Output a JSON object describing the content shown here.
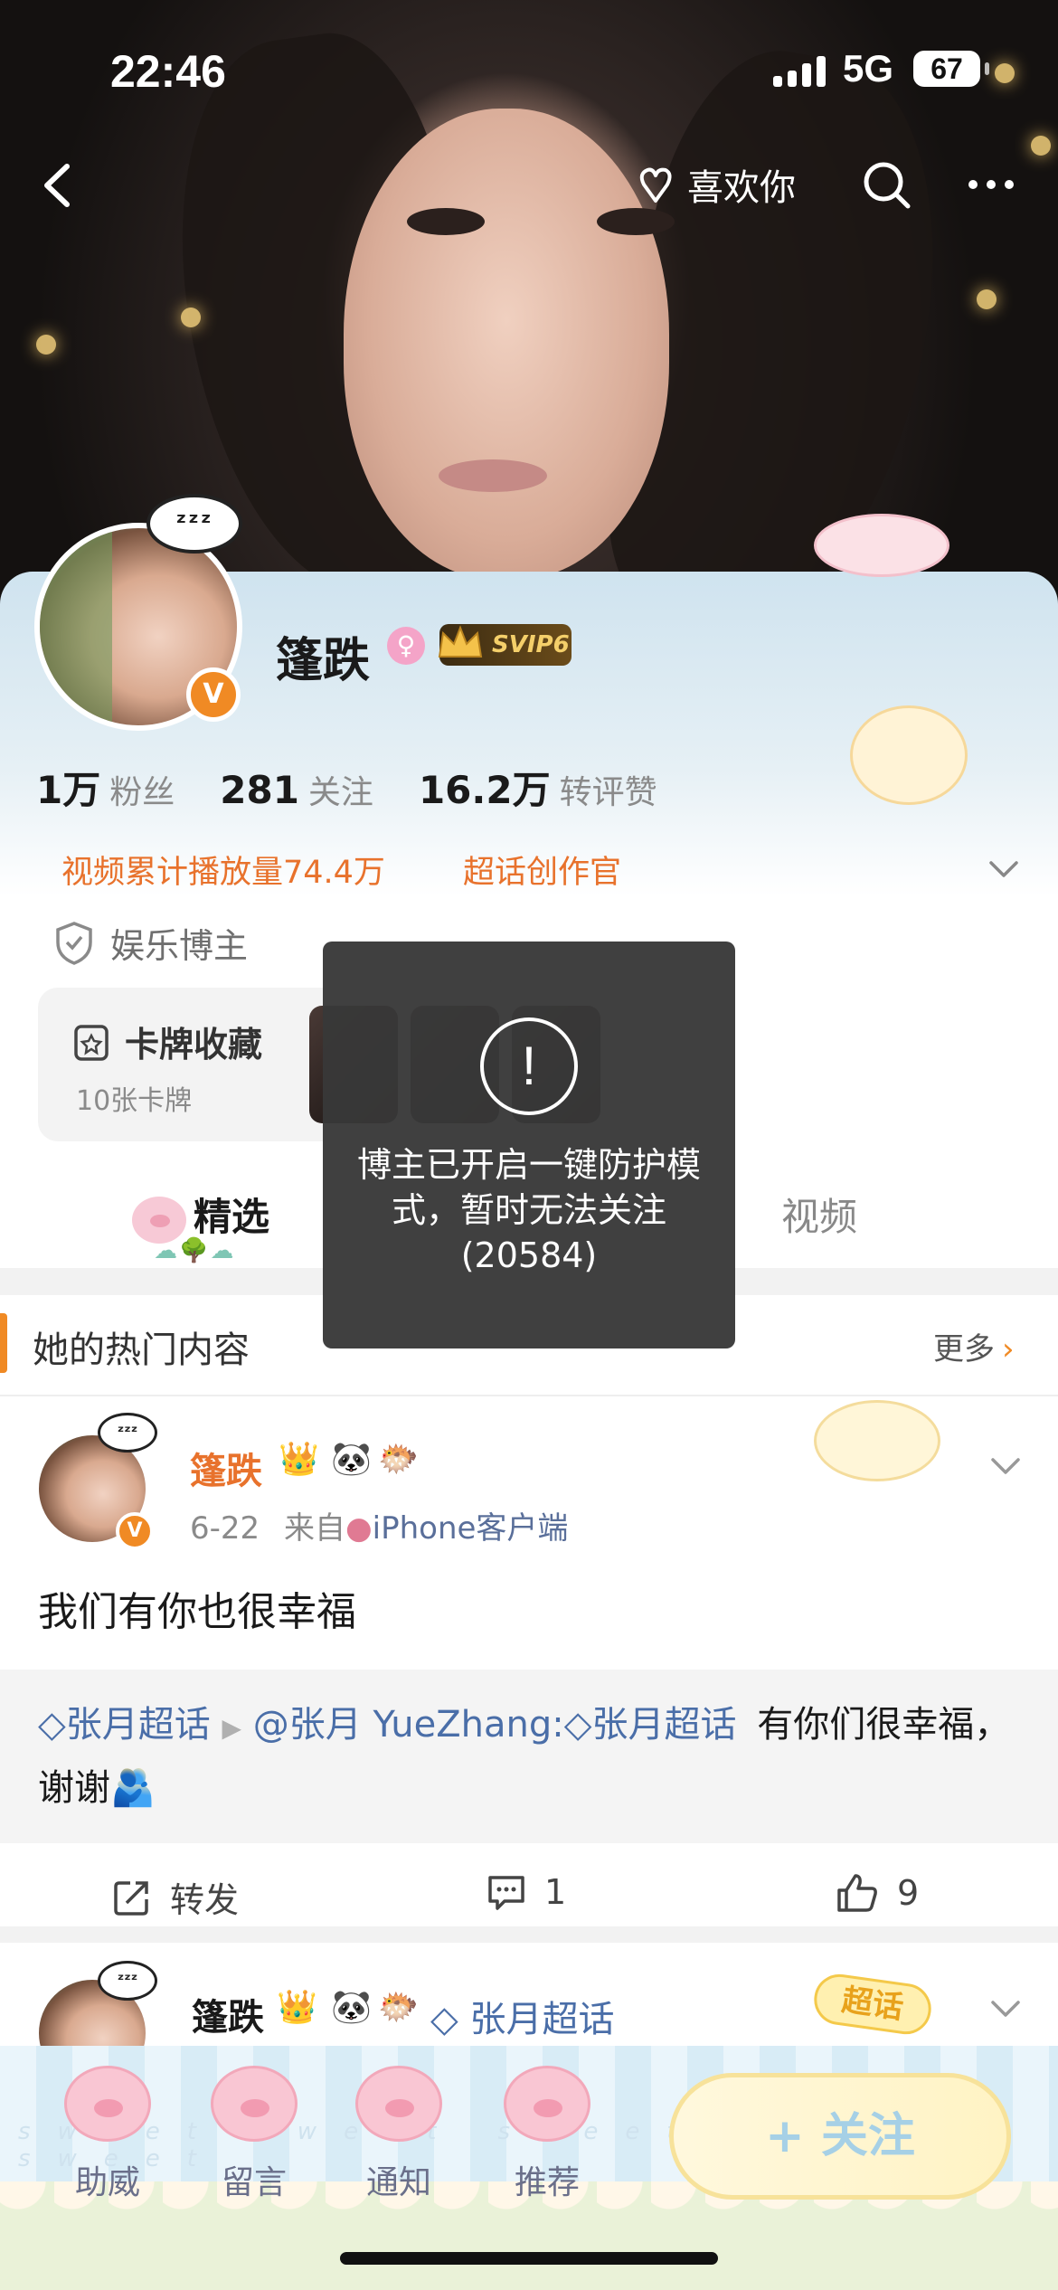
{
  "status_bar": {
    "time": "22:46",
    "network": "5G",
    "battery": "67"
  },
  "nav": {
    "like_label": "喜欢你",
    "icons": [
      "back-icon",
      "heart-hand-icon",
      "search-icon",
      "more-icon"
    ]
  },
  "profile": {
    "name": "篷跌",
    "gender_symbol": "♀",
    "svip_label": "SVIP6",
    "avatar_bubble": "ᶻᶻᶻ",
    "verified_mark": "V",
    "stats": [
      {
        "num": "1万",
        "label": "粉丝"
      },
      {
        "num": "281",
        "label": "关注"
      },
      {
        "num": "16.2万",
        "label": "转评赞"
      }
    ],
    "tag_video": "视频累计播放量74.4万",
    "tag_super": "超话创作官",
    "certification": "娱乐博主",
    "cards_title": "卡牌收藏",
    "cards_sub": "10张卡牌"
  },
  "tabs": {
    "selected": "精选",
    "video": "视频"
  },
  "hot_section": {
    "title": "她的热门内容",
    "more": "更多"
  },
  "post1": {
    "name": "篷跌",
    "date": "6-22",
    "from": "来自",
    "source": "iPhone客户端",
    "text": "我们有你也很幸福",
    "repost_topic": "张月超话",
    "repost_user": "@张月 YueZhang:",
    "repost_topic2": "张月超话",
    "repost_text": "有你们很幸福，谢谢",
    "repost_label": "转发",
    "comment_count": "1",
    "like_count": "9"
  },
  "post2": {
    "name": "篷跌",
    "topic": "张月超话",
    "super_badge": "超话"
  },
  "toast": {
    "icon": "!",
    "message": "博主已开启一键防护模式，暂时无法关注(20584)"
  },
  "bottom_bar": {
    "items": [
      "助威",
      "留言",
      "通知",
      "推荐"
    ],
    "follow_label": "+ 关注"
  },
  "colors": {
    "accent_orange": "#e8722c",
    "link_blue": "#4a6ea8",
    "toast_bg": "#383838"
  }
}
